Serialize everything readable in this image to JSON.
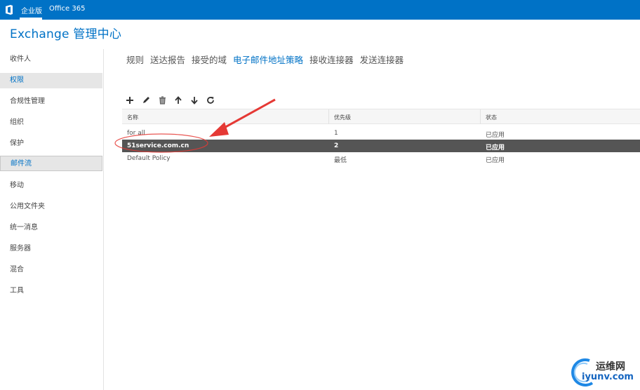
{
  "topbar": {
    "enterprise_label": "企业版",
    "office_label": "Office 365"
  },
  "app": {
    "title": "Exchange 管理中心"
  },
  "sidebar": {
    "items": [
      {
        "label": "收件人",
        "active": false
      },
      {
        "label": "权限",
        "active": true
      },
      {
        "label": "合规性管理",
        "active": false
      },
      {
        "label": "组织",
        "active": false
      },
      {
        "label": "保护",
        "active": false
      },
      {
        "label": "邮件流",
        "active": true
      },
      {
        "label": "移动",
        "active": false
      },
      {
        "label": "公用文件夹",
        "active": false
      },
      {
        "label": "统一消息",
        "active": false
      },
      {
        "label": "服务器",
        "active": false
      },
      {
        "label": "混合",
        "active": false
      },
      {
        "label": "工具",
        "active": false
      }
    ]
  },
  "tabs": [
    {
      "label": "规则",
      "active": false
    },
    {
      "label": "送达报告",
      "active": false
    },
    {
      "label": "接受的域",
      "active": false
    },
    {
      "label": "电子邮件地址策略",
      "active": true
    },
    {
      "label": "接收连接器",
      "active": false
    },
    {
      "label": "发送连接器",
      "active": false
    }
  ],
  "toolbar": {
    "icons": [
      "add-icon",
      "edit-icon",
      "delete-icon",
      "move-up-icon",
      "move-down-icon",
      "refresh-icon"
    ]
  },
  "table": {
    "columns": [
      "名称",
      "优先级",
      "状态"
    ],
    "rows": [
      {
        "name": "for all",
        "priority": "1",
        "status": "已应用",
        "selected": false
      },
      {
        "name": "51service.com.cn",
        "priority": "2",
        "status": "已应用",
        "selected": true
      },
      {
        "name": "Default Policy",
        "priority": "最低",
        "status": "已应用",
        "selected": false
      }
    ]
  },
  "annotation": {
    "color": "#e53935"
  },
  "watermark": {
    "cn": "运维网",
    "en": "iyunv.com"
  },
  "colors": {
    "accent": "#0072c6",
    "selected_row": "#555555"
  }
}
